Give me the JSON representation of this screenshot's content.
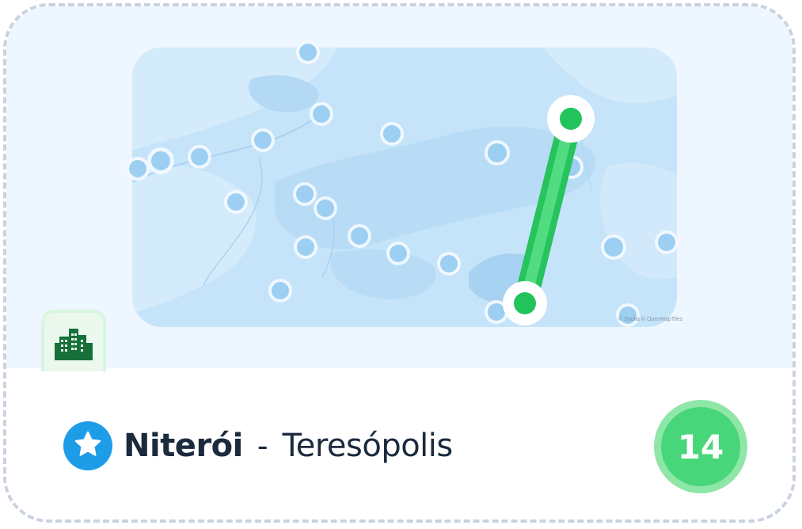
{
  "route": {
    "origin": "Niterói",
    "separator": "-",
    "destination": "Teresópolis",
    "count": "14"
  },
  "map": {
    "attribution": "© Stadia © OpenMapTiles",
    "water_color": "#c5e4fa",
    "route_color": "#27c35c"
  },
  "icons": {
    "badge": "building-icon",
    "favorite": "star-icon"
  },
  "colors": {
    "accent_blue": "#1d9ce8",
    "accent_green": "#48d67b",
    "text_dark": "#1b2a3d"
  }
}
